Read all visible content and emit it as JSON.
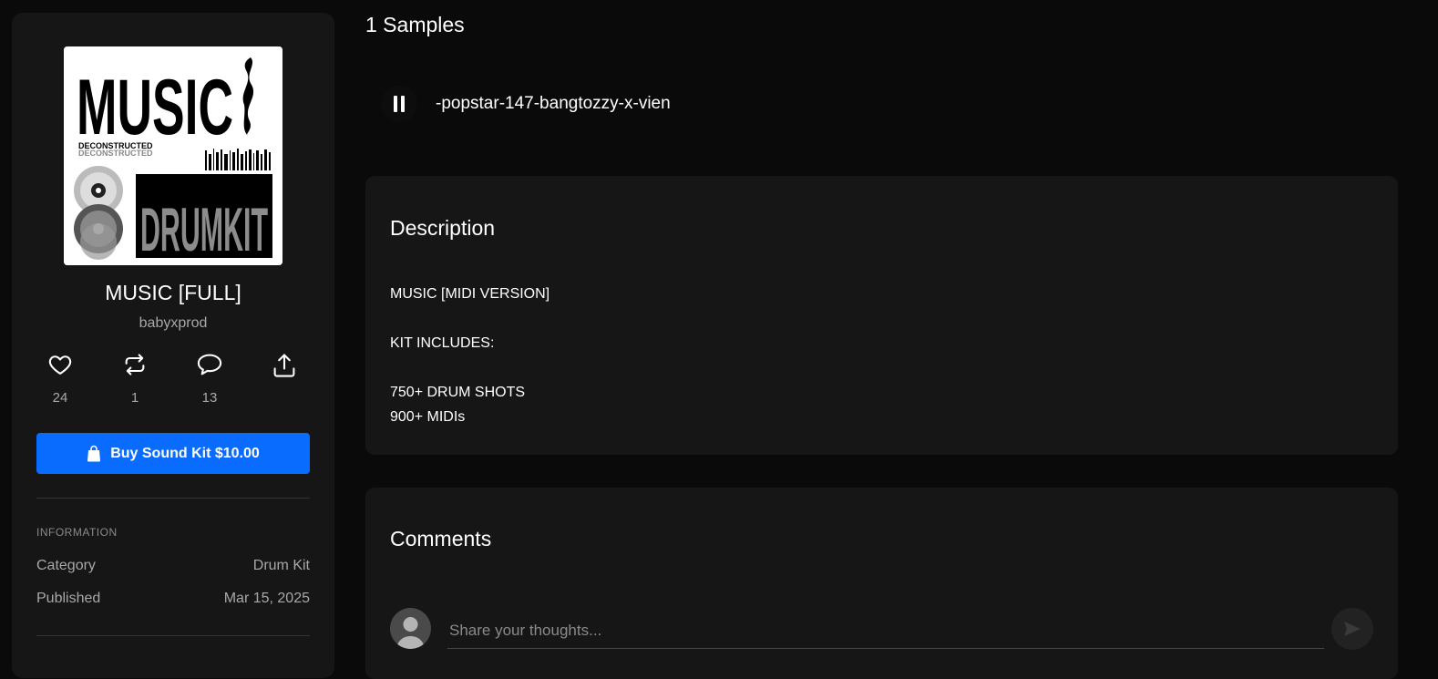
{
  "kit": {
    "title": "MUSIC [FULL]",
    "author": "babyxprod",
    "cover_text_top": "MUSIC",
    "cover_text_sub1": "DECONSTRUCTED",
    "cover_text_sub2": "DECONSTRUCTED",
    "cover_text_main": "DRUMKIT"
  },
  "actions": [
    {
      "icon": "heart-icon",
      "count": "24"
    },
    {
      "icon": "repost-icon",
      "count": "1"
    },
    {
      "icon": "comment-icon",
      "count": "13"
    },
    {
      "icon": "share-icon",
      "count": ""
    }
  ],
  "buy_button": {
    "label": "Buy Sound Kit $10.00",
    "icon": "bag-icon",
    "color": "#0a6cff"
  },
  "information": {
    "heading": "INFORMATION",
    "rows": [
      {
        "label": "Category",
        "value": "Drum Kit"
      },
      {
        "label": "Published",
        "value": "Mar 15, 2025"
      }
    ]
  },
  "samples": {
    "heading": "1 Samples",
    "tracks": [
      {
        "name": "-popstar-147-bangtozzy-x-vien",
        "state_icon": "pause-icon"
      }
    ]
  },
  "description": {
    "heading": "Description",
    "lines": [
      "MUSIC [MIDI VERSION]",
      "KIT INCLUDES:",
      "750+ DRUM SHOTS",
      "900+ MIDIs"
    ]
  },
  "comments": {
    "heading": "Comments",
    "placeholder": "Share your thoughts..."
  }
}
